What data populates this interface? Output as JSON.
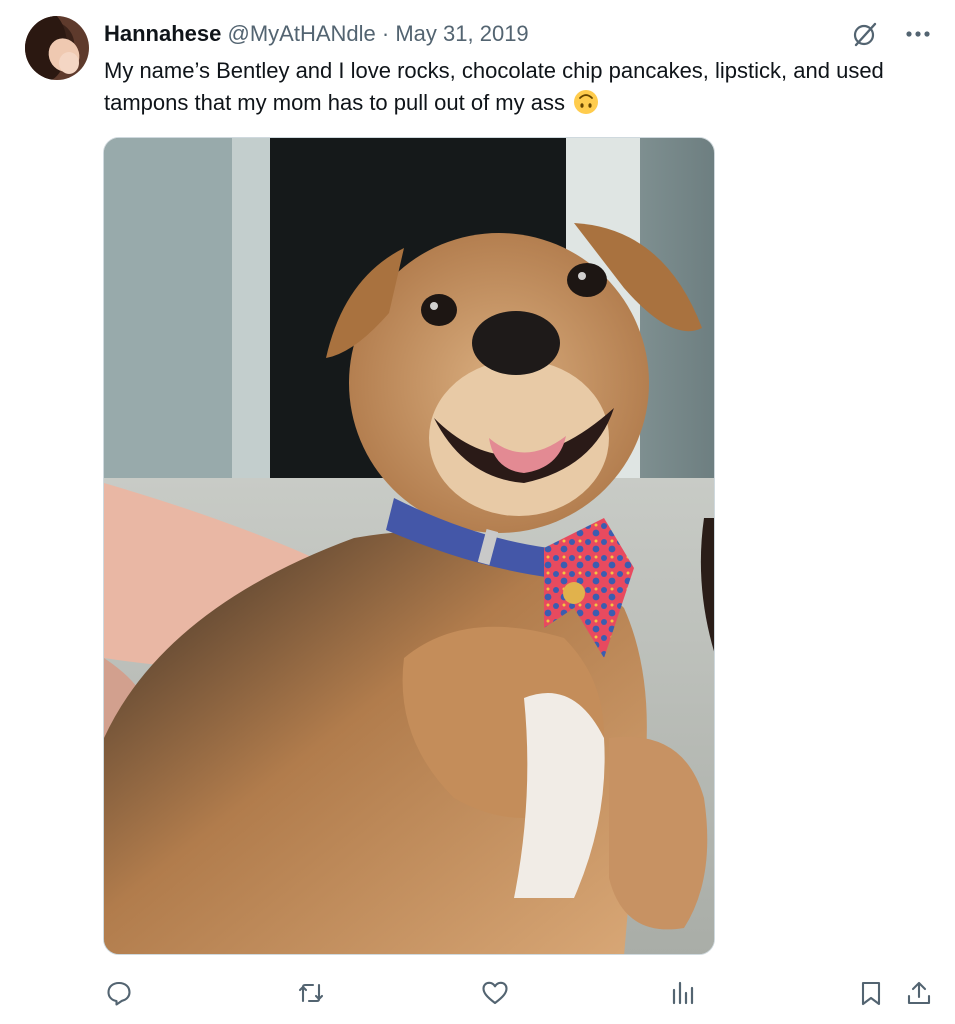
{
  "tweet": {
    "author": {
      "display_name": "Hannahese",
      "handle": "@MyAtHANdle",
      "separator": "·",
      "date": "May 31, 2019"
    },
    "text": "My name’s Bentley and I love rocks, chocolate chip pancakes, lipstick, and used tampons that my mom has to pull out of my ass",
    "emoji": "upside-down-face",
    "media": {
      "kind": "photo",
      "subject": "dog-with-bowtie"
    },
    "actions": [
      "reply-icon",
      "retweet-icon",
      "like-icon",
      "views-icon",
      "bookmark-icon",
      "share-icon"
    ]
  },
  "colors": {
    "text_primary": "#0f1419",
    "text_secondary": "#536471",
    "border": "#cfd9de"
  }
}
